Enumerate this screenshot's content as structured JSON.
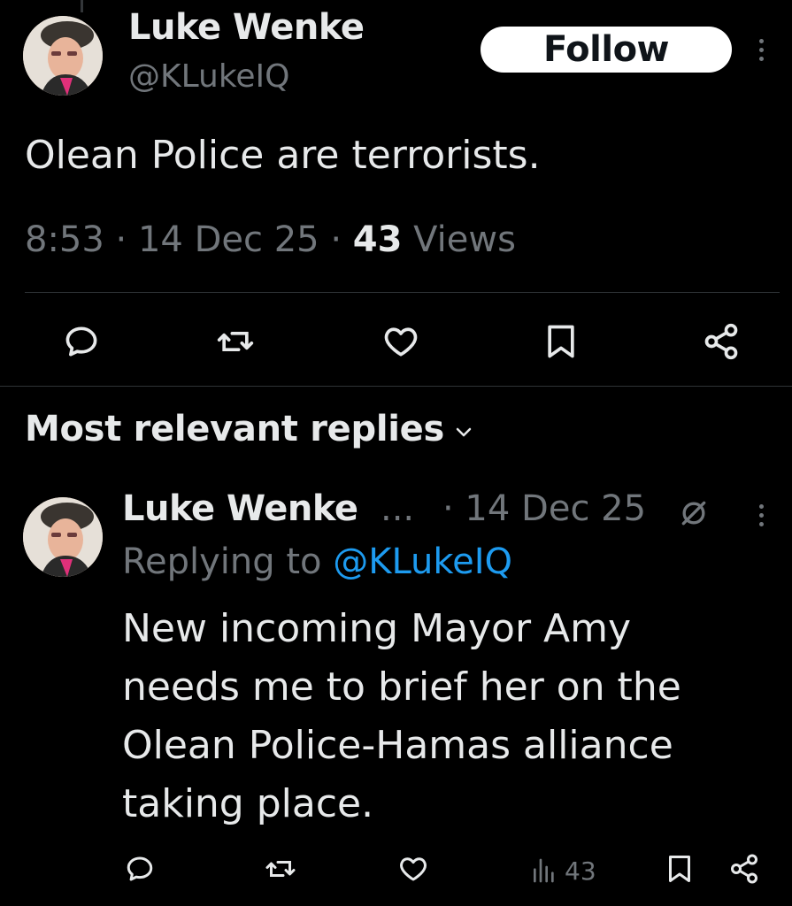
{
  "tweet": {
    "author_name": "Luke Wenke",
    "author_handle": "@KLukeIQ",
    "follow_label": "Follow",
    "text": "Olean Police are terrorists.",
    "time": "8:53",
    "separator": "·",
    "date": "14 Dec 25",
    "views_count": "43",
    "views_label": "Views"
  },
  "replies_section": {
    "title": "Most relevant replies"
  },
  "reply": {
    "author_name": "Luke Wenke",
    "ellipsis": "...",
    "date": "· 14 Dec 25",
    "replying_prefix": "Replying to",
    "replying_mention": "@KLukeIQ",
    "body_lines": [
      "New incoming Mayor Amy",
      "needs me to brief her on the",
      "Olean Police-Hamas alliance",
      "taking place."
    ],
    "views_count": "43"
  },
  "icons": {
    "reply": "comment-icon",
    "retweet": "retweet-icon",
    "like": "heart-icon",
    "bookmark": "bookmark-icon",
    "share": "share-icon",
    "views": "views-icon",
    "more": "more-vertical-icon",
    "grok": "grok-icon",
    "chevron": "chevron-down-icon"
  },
  "colors": {
    "background": "#000000",
    "text_primary": "#e7e9ea",
    "text_secondary": "#71767b",
    "link": "#1d9bf0",
    "divider": "#2f3336",
    "follow_bg": "#ffffff"
  }
}
